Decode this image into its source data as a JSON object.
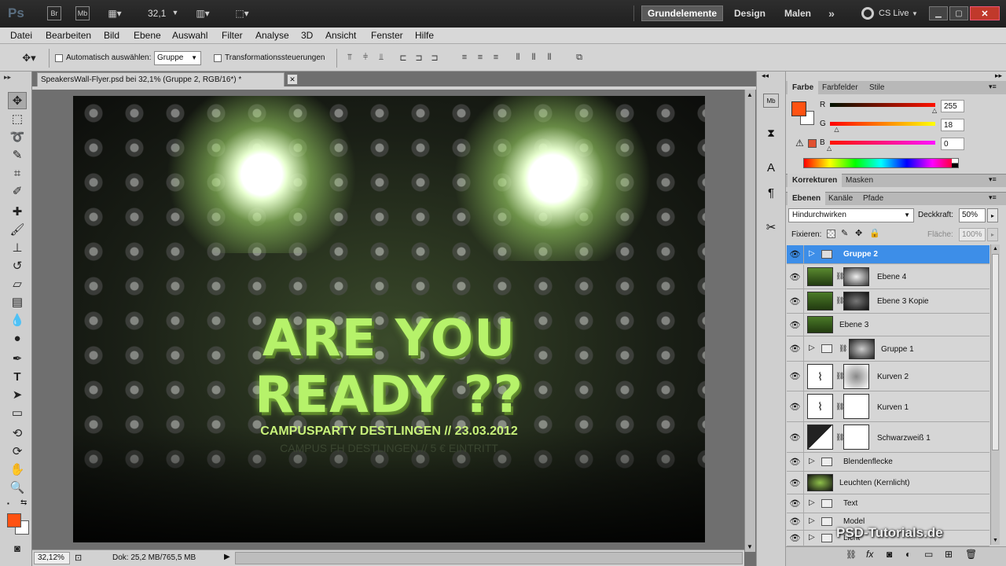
{
  "app": {
    "logo": "Ps",
    "zoom": "32,1",
    "workspaces": [
      "Grundelemente",
      "Design",
      "Malen"
    ],
    "cs_live": "CS Live"
  },
  "menu": [
    "Datei",
    "Bearbeiten",
    "Bild",
    "Ebene",
    "Auswahl",
    "Filter",
    "Analyse",
    "3D",
    "Ansicht",
    "Fenster",
    "Hilfe"
  ],
  "options": {
    "auto_select_label": "Automatisch auswählen:",
    "auto_select_value": "Gruppe",
    "transform_label": "Transformationssteuerungen"
  },
  "document": {
    "tab_title": "SpeakersWall-Flyer.psd bei 32,1% (Gruppe 2, RGB/16*) *",
    "zoom_field": "32,12%",
    "doc_info": "Dok: 25,2 MB/765,5 MB"
  },
  "poster": {
    "line1": "ARE YOU",
    "line2": "READY ??",
    "subtitle": "CAMPUSPARTY DESTLINGEN // 23.03.2012",
    "subtitle2": "CAMPUS FH DESTLINGEN  //  5 € EINTRITT"
  },
  "color_panel": {
    "tabs": [
      "Farbe",
      "Farbfelder",
      "Stile"
    ],
    "r_label": "R",
    "g_label": "G",
    "b_label": "B",
    "r": "255",
    "g": "18",
    "b": "0",
    "r_frac": 1.0,
    "g_frac": 0.07,
    "b_frac": 0.0,
    "fg_color": "#ff5212"
  },
  "adjust_panel": {
    "tabs": [
      "Korrekturen",
      "Masken"
    ]
  },
  "layers_panel": {
    "tabs": [
      "Ebenen",
      "Kanäle",
      "Pfade"
    ],
    "blend_mode": "Hindurchwirken",
    "opacity_label": "Deckkraft:",
    "opacity": "50%",
    "lock_label": "Fixieren:",
    "fill_label": "Fläche:",
    "fill": "100%",
    "layers": [
      {
        "name": "Gruppe 2"
      },
      {
        "name": "Ebene 4"
      },
      {
        "name": "Ebene 3 Kopie"
      },
      {
        "name": "Ebene 3"
      },
      {
        "name": "Gruppe 1"
      },
      {
        "name": "Kurven 2"
      },
      {
        "name": "Kurven 1"
      },
      {
        "name": "Schwarzweiß 1"
      },
      {
        "name": "Blendenflecke"
      },
      {
        "name": "Leuchten (Kernlicht)"
      },
      {
        "name": "Text"
      },
      {
        "name": "Model"
      },
      {
        "name": "Licht"
      }
    ]
  },
  "watermark": "PSD-Tutorials.de"
}
